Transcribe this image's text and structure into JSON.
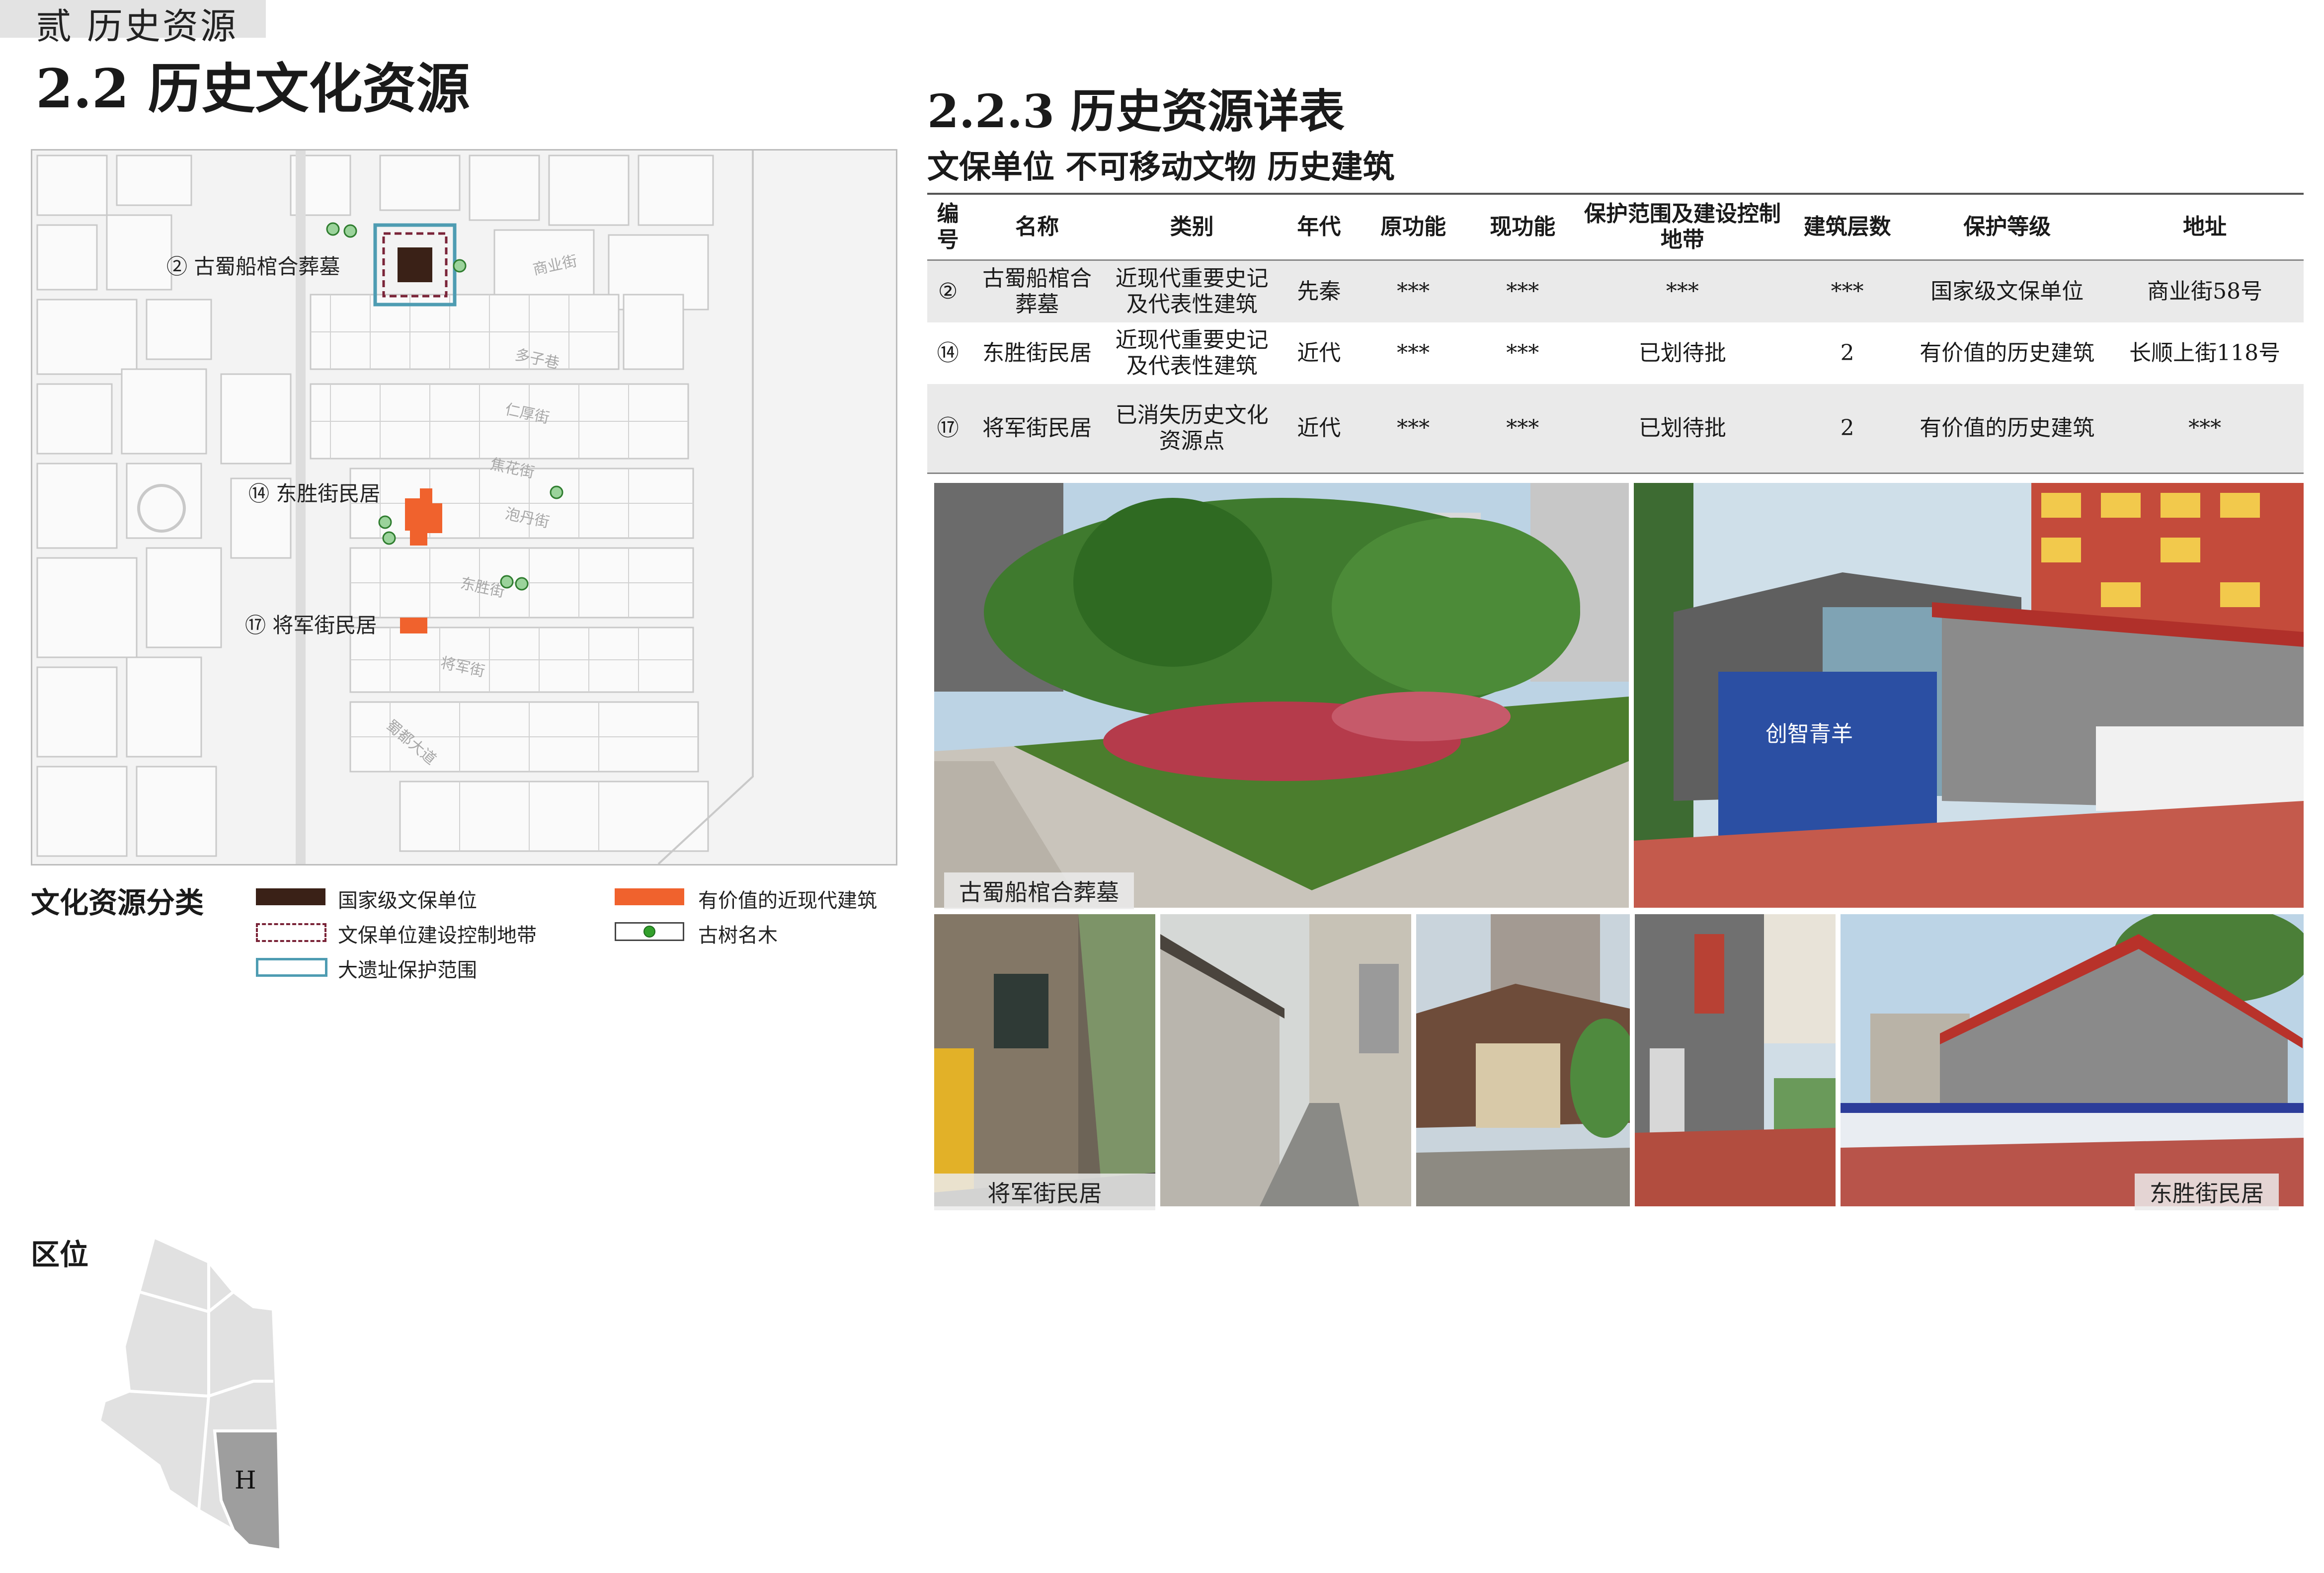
{
  "header": {
    "chapter": "贰 历史资源",
    "section_title": "2.2 历史文化资源",
    "sub_title": "2.2.3 历史资源详表",
    "category_title": "文保单位 不可移动文物 历史建筑"
  },
  "map": {
    "labels": {
      "site2": "② 古蜀船棺合葬墓",
      "site14": "⑭ 东胜街民居",
      "site17": "⑰ 将军街民居"
    },
    "streets": [
      "商业街",
      "多子巷",
      "仁厚街",
      "焦花街",
      "泡丹街",
      "东胜街",
      "将军街",
      "蜀都大道"
    ]
  },
  "legend": {
    "title": "文化资源分类",
    "items": {
      "national": "国家级文保单位",
      "control_zone": "文保单位建设控制地带",
      "site_range": "大遗址保护范围",
      "modern": "有价值的近现代建筑",
      "tree": "古树名木"
    },
    "colors": {
      "national": "#3a2117",
      "control_zone": "#7a2438",
      "site_range": "#4e9cb2",
      "modern": "#f0622d",
      "tree": "#33a02c"
    }
  },
  "location": {
    "title": "区位",
    "marker": "H"
  },
  "table": {
    "headers": [
      "编号",
      "名称",
      "类别",
      "年代",
      "原功能",
      "现功能",
      "保护范围及建设控制地带",
      "建筑层数",
      "保护等级",
      "地址"
    ],
    "rows": [
      [
        "②",
        "古蜀船棺合葬墓",
        "近现代重要史记及代表性建筑",
        "先秦",
        "***",
        "***",
        "***",
        "***",
        "国家级文保单位",
        "商业街58号"
      ],
      [
        "⑭",
        "东胜街民居",
        "近现代重要史记及代表性建筑",
        "近代",
        "***",
        "***",
        "已划待批",
        "2",
        "有价值的历史建筑",
        "长顺上街118号"
      ],
      [
        "⑰",
        "将军街民居",
        "已消失历史文化资源点",
        "近代",
        "***",
        "***",
        "已划待批",
        "2",
        "有价值的历史建筑",
        "***"
      ]
    ]
  },
  "photos": {
    "captions": {
      "tomb": "古蜀船棺合葬墓",
      "jiangjun": "将军街民居",
      "dongsheng": "东胜街民居"
    },
    "exhibit_sign": "创智青羊"
  }
}
